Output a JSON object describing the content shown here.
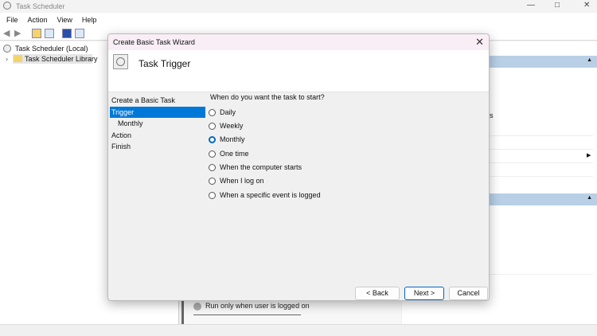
{
  "app": {
    "title": "Task Scheduler",
    "menu": [
      "File",
      "Action",
      "View",
      "Help"
    ],
    "tree": [
      "Task Scheduler (Local)",
      "Task Scheduler Library"
    ],
    "background_text": "Run only when user is logged on",
    "partial_text": "s"
  },
  "dialog": {
    "title": "Create Basic Task Wizard",
    "header": "Task Trigger",
    "nav": [
      "Create a Basic Task",
      "Trigger",
      "Monthly",
      "Action",
      "Finish"
    ],
    "question": "When do you want the task to start?",
    "options": [
      "Daily",
      "Weekly",
      "Monthly",
      "One time",
      "When the computer starts",
      "When I log on",
      "When a specific event is logged"
    ],
    "selected": "Monthly",
    "buttons": {
      "back": "< Back",
      "next": "Next >",
      "cancel": "Cancel"
    }
  }
}
